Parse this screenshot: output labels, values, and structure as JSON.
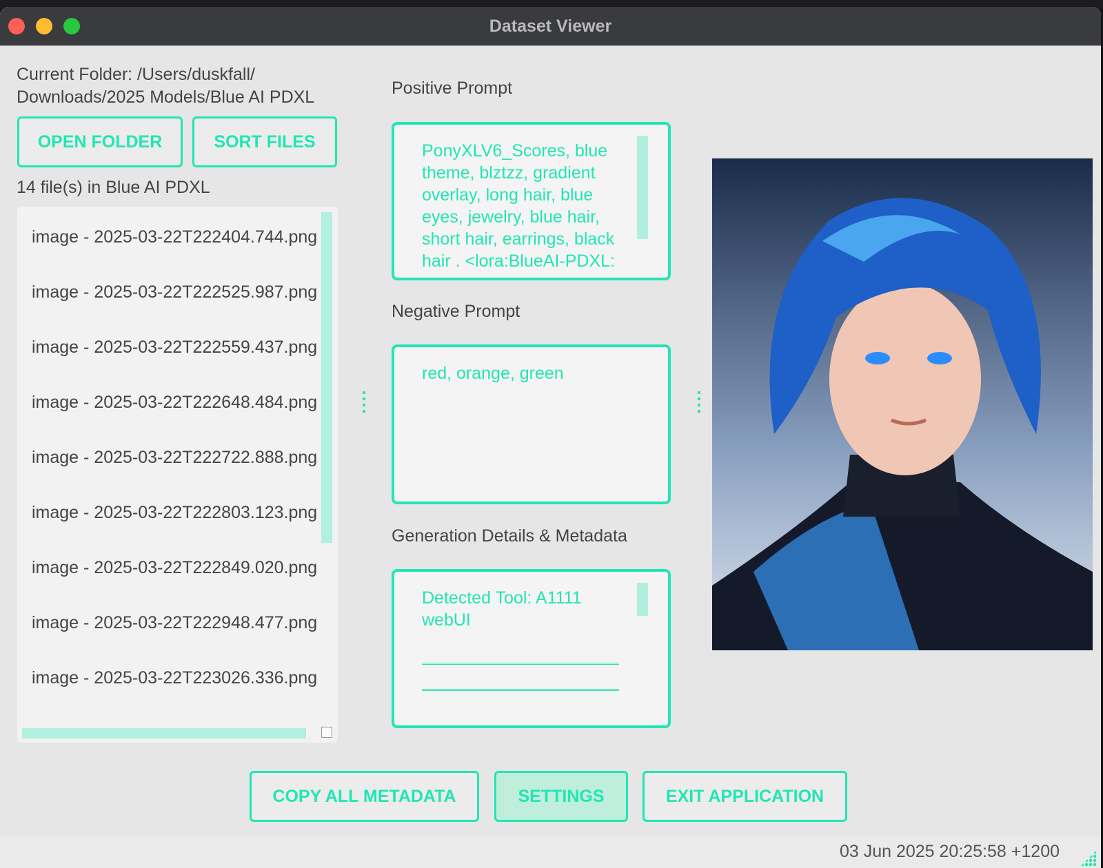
{
  "window": {
    "title": "Dataset Viewer"
  },
  "folder": {
    "current_label": "Current Folder: /Users/duskfall/",
    "current_label_line2": "Downloads/2025 Models/Blue AI PDXL",
    "open_button": "OPEN FOLDER",
    "sort_button": "SORT FILES",
    "count_text": "14 file(s) in Blue AI PDXL"
  },
  "files": [
    "image - 2025-03-22T222404.744.png",
    "image - 2025-03-22T222525.987.png",
    "image - 2025-03-22T222559.437.png",
    "image - 2025-03-22T222648.484.png",
    "image - 2025-03-22T222722.888.png",
    "image - 2025-03-22T222803.123.png",
    "image - 2025-03-22T222849.020.png",
    "image - 2025-03-22T222948.477.png",
    "image - 2025-03-22T223026.336.png"
  ],
  "positive": {
    "label": "Positive Prompt",
    "text": "PonyXLV6_Scores, blue theme, blztzz, gradient overlay, long hair, blue eyes, jewelry, blue hair, short hair, earrings, black hair . <lora:BlueAI-PDXL:"
  },
  "negative": {
    "label": "Negative Prompt",
    "text": "red, orange, green"
  },
  "details": {
    "label": "Generation Details & Metadata",
    "text": "Detected Tool: A1111 webUI"
  },
  "buttons": {
    "copy": "COPY ALL METADATA",
    "settings": "SETTINGS",
    "exit": "EXIT APPLICATION"
  },
  "status": {
    "datetime": "03 Jun 2025 20:25:58 +1200"
  },
  "colors": {
    "accent": "#21e6b3",
    "accent_light": "#b1efdf"
  }
}
